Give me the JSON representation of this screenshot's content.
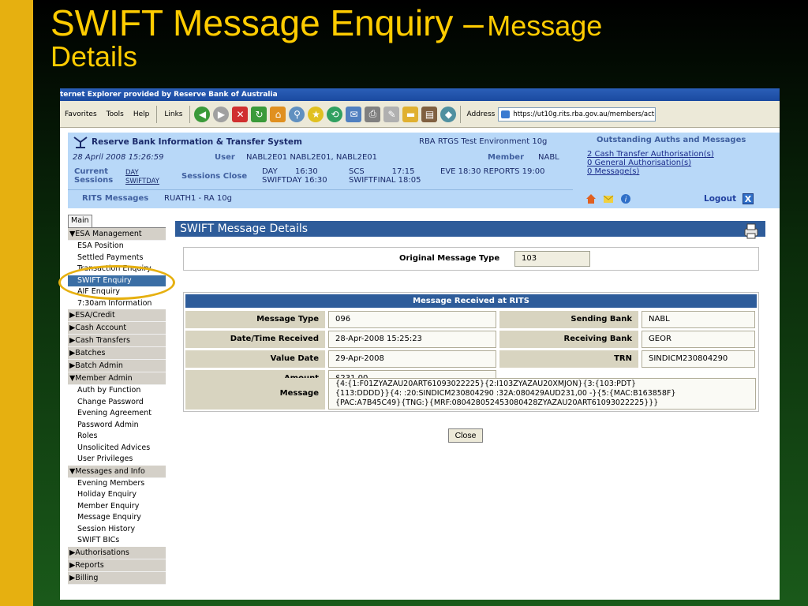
{
  "slide": {
    "title_main": "SWIFT Message Enquiry –",
    "title_sub": "Message",
    "title_line2": "Details"
  },
  "browser": {
    "title": "ternet Explorer provided by Reserve Bank of Australia",
    "menu": [
      "Favorites",
      "Tools",
      "Help"
    ],
    "links_label": "Links",
    "address_label": "Address",
    "address_url": "https://ut10g.rits.rba.gov.au/members/acti"
  },
  "header": {
    "brand": "Reserve Bank Information & Transfer System",
    "environment": "RBA RTGS Test Environment 10g",
    "datetime": "28 April 2008 15:26:59",
    "user_label": "User",
    "user_value": "NABL2E01 NABL2E01, NABL2E01",
    "member_label": "Member",
    "member_value": "NABL",
    "current_sessions_label": "Current Sessions",
    "sessions": [
      "DAY",
      "SWIFTDAY"
    ],
    "sessions_close_label": "Sessions Close",
    "close_times_line1": "DAY       16:30",
    "close_times_line2": "SWIFTDAY 16:30",
    "close_times_col2_line1": "SCS           17:15",
    "close_times_col2_line2": "SWIFTFINAL 18:05",
    "close_times_col3": "EVE 18:30 REPORTS 19:00",
    "rits_messages_label": "RITS Messages",
    "rits_messages_value": "RUATH1 - RA 10g",
    "outstanding_title": "Outstanding Auths and Messages",
    "outstanding_links": [
      "2 Cash Transfer Authorisation(s)",
      "0 General Authorisation(s)",
      "0 Message(s)"
    ],
    "logout": "Logout",
    "close_x": "X"
  },
  "sidebar": {
    "tab": "Main",
    "groups": [
      {
        "label": "▼ESA Management",
        "items": [
          "ESA Position",
          "Settled Payments",
          "Transaction Enquiry",
          "SWIFT Enquiry",
          "AIF Enquiry",
          "7:30am Information"
        ]
      },
      {
        "label": "▶ESA/Credit",
        "items": []
      },
      {
        "label": "▶Cash Account",
        "items": []
      },
      {
        "label": "▶Cash Transfers",
        "items": []
      },
      {
        "label": "▶Batches",
        "items": []
      },
      {
        "label": "▶Batch Admin",
        "items": []
      },
      {
        "label": "▼Member Admin",
        "items": [
          "Auth by Function",
          "Change Password",
          "Evening Agreement",
          "Password Admin",
          "Roles",
          "Unsolicited Advices",
          "User Privileges"
        ]
      },
      {
        "label": "▼Messages and Info",
        "items": [
          "Evening Members",
          "Holiday Enquiry",
          "Member Enquiry",
          "Message Enquiry",
          "Session History",
          "SWIFT BICs"
        ]
      },
      {
        "label": "▶Authorisations",
        "items": []
      },
      {
        "label": "▶Reports",
        "items": []
      },
      {
        "label": "▶Billing",
        "items": []
      }
    ],
    "active_item": "SWIFT Enquiry"
  },
  "content": {
    "page_title": "SWIFT Message Details",
    "original_message_type_label": "Original Message Type",
    "original_message_type_value": "103",
    "received_title": "Message Received at RITS",
    "message_type_label": "Message Type",
    "message_type_value": "096",
    "sending_bank_label": "Sending Bank",
    "sending_bank_value": "NABL",
    "date_received_label": "Date/Time Received",
    "date_received_value": "28-Apr-2008 15:25:23",
    "receiving_bank_label": "Receiving Bank",
    "receiving_bank_value": "GEOR",
    "value_date_label": "Value Date",
    "value_date_value": "29-Apr-2008",
    "trn_label": "TRN",
    "trn_value": "SINDICM230804290",
    "amount_label": "Amount",
    "amount_value": "$231.00",
    "message_label": "Message",
    "message_line1": "{4:{1:F01ZYAZAU20ART61093022225}{2:I103ZYAZAU20XMJON}{3:{103:PDT}",
    "message_line2": "{113:DDDD}}{4: :20:SINDICM230804290 :32A:080429AUD231,00 -}{5:{MAC:B163858F}",
    "message_line3": "{PAC:A7B45C49}{TNG:}{MRF:080428052453080428ZYAZAU20ART61093022225}}}",
    "close_button": "Close"
  }
}
